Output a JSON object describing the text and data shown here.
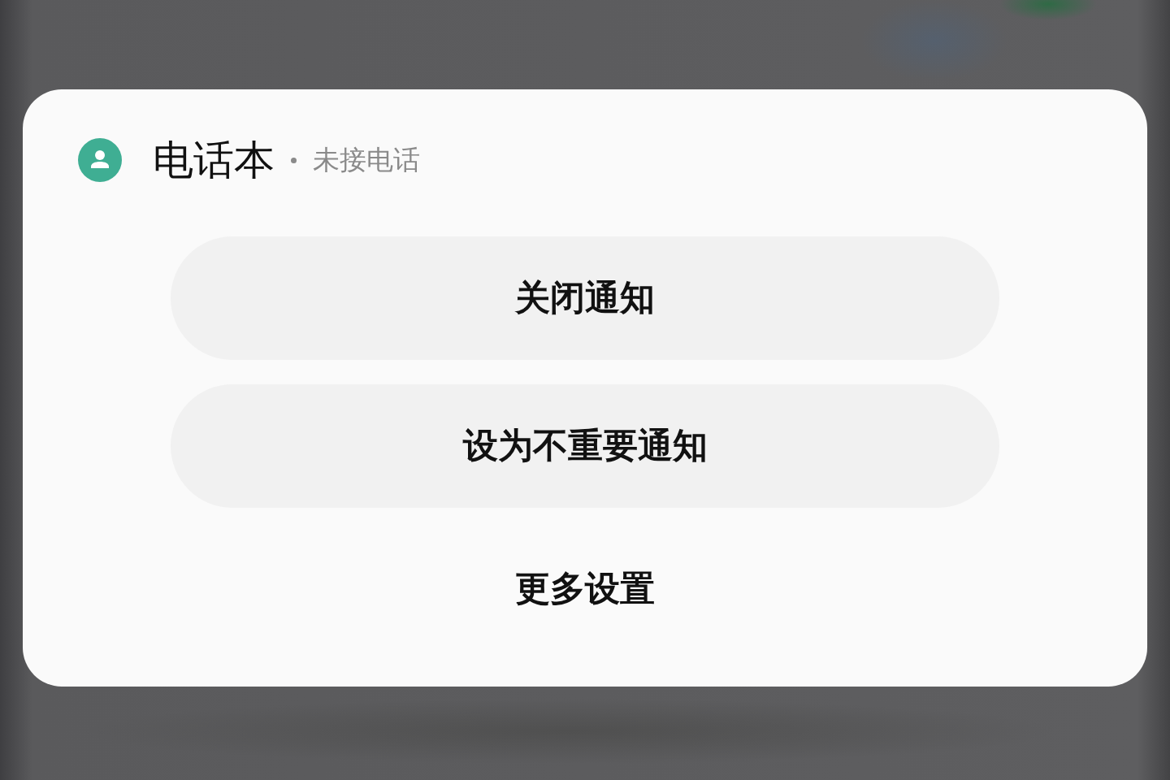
{
  "notification": {
    "app_name": "电话本",
    "category": "未接电话"
  },
  "actions": [
    {
      "label": "关闭通知",
      "kind": "pill"
    },
    {
      "label": "设为不重要通知",
      "kind": "pill"
    },
    {
      "label": "更多设置",
      "kind": "plain"
    }
  ]
}
